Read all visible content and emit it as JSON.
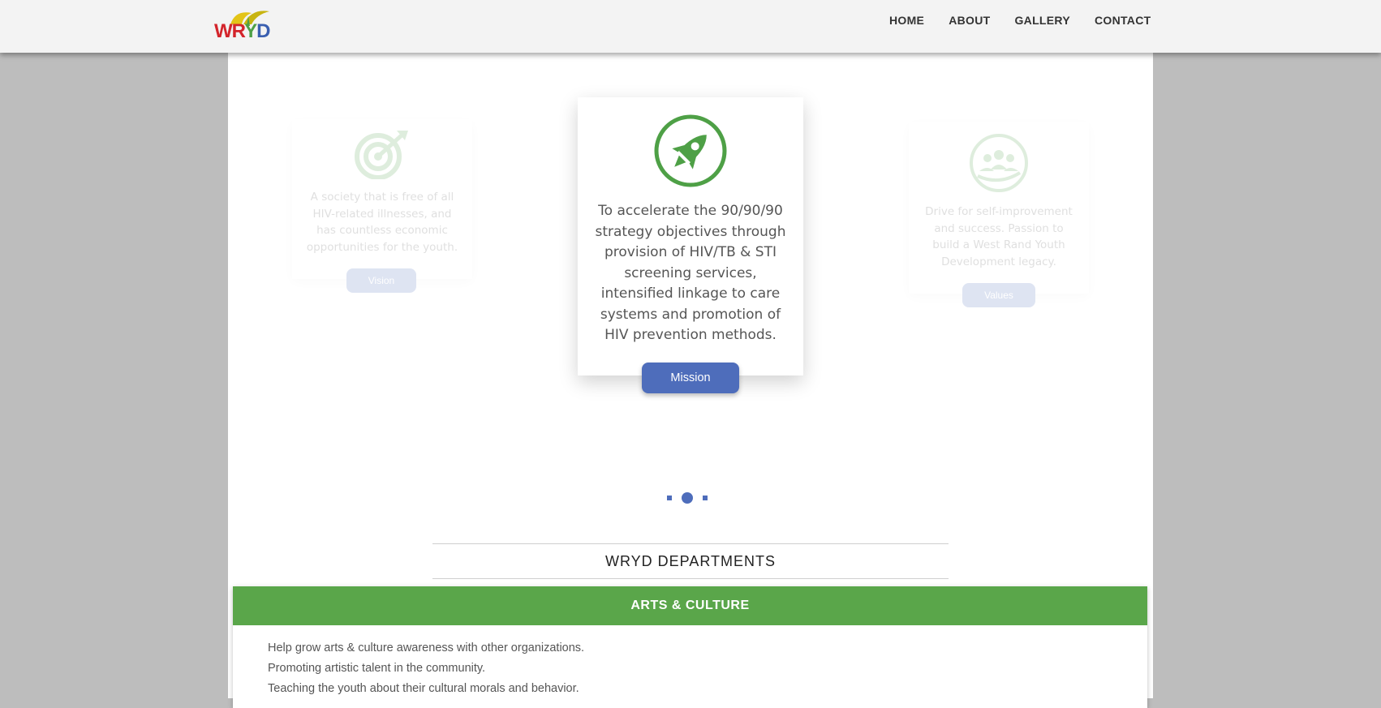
{
  "header": {
    "logo_text": "WRYD",
    "nav": [
      "HOME",
      "ABOUT",
      "GALLERY",
      "CONTACT"
    ]
  },
  "cards": {
    "vision": {
      "text": "A society that is free of all HIV-related illnesses, and has countless economic opportunities for the youth.",
      "button": "Vision",
      "icon": "target-icon"
    },
    "mission": {
      "text": "To accelerate the 90/90/90 strategy objectives through provision of HIV/TB & STI screening services, intensified linkage to care systems and promotion of HIV prevention methods.",
      "button": "Mission",
      "icon": "rocket-icon"
    },
    "values": {
      "text": "Drive for self-improvement and success. Passion to build a West Rand Youth Development legacy.",
      "button": "Values",
      "icon": "people-in-hand-icon"
    }
  },
  "departments": {
    "title": "WRYD DEPARTMENTS",
    "current": {
      "name": "ARTS & CULTURE",
      "items": [
        "Help grow arts & culture awareness with other organizations.",
        "Promoting artistic talent in the community.",
        "Teaching the youth about their cultural morals and behavior."
      ]
    }
  },
  "colors": {
    "accent_blue": "#4e6dbb",
    "accent_green": "#5aa64a",
    "icon_green": "#4ea046"
  }
}
